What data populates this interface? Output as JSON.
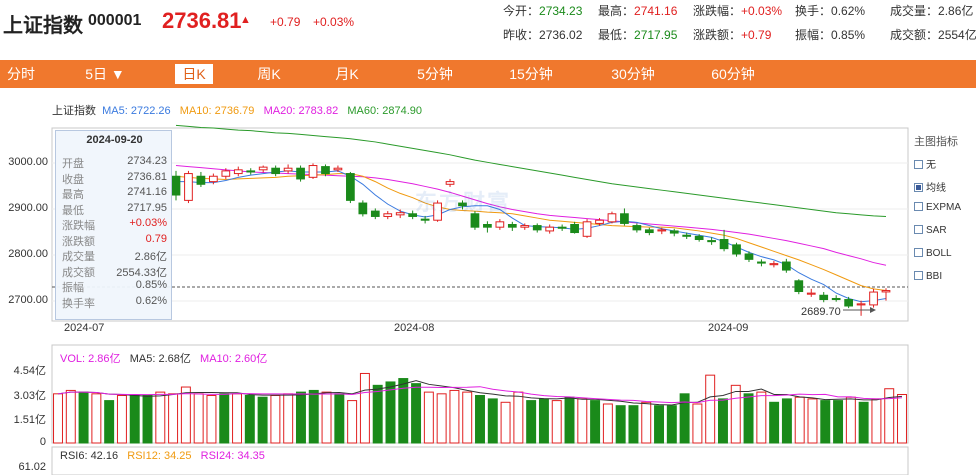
{
  "header": {
    "name": "上证指数",
    "code": "000001",
    "price": "2736.81",
    "arrow": "▲",
    "change": "+0.79",
    "pct": "+0.03%",
    "stats": [
      {
        "label": "今开：",
        "value": "2734.23",
        "tone": "green"
      },
      {
        "label": "最高：",
        "value": "2741.16",
        "tone": "red"
      },
      {
        "label": "涨跌幅：",
        "value": "+0.03%",
        "tone": "red"
      },
      {
        "label": "换手：",
        "value": "0.62%",
        "tone": "plain"
      },
      {
        "label": "成交量：",
        "value": "2.86亿",
        "tone": "plain"
      },
      {
        "label": "昨收：",
        "value": "2736.02",
        "tone": "plain"
      },
      {
        "label": "最低：",
        "value": "2717.95",
        "tone": "green"
      },
      {
        "label": "涨跌额：",
        "value": "+0.79",
        "tone": "red"
      },
      {
        "label": "振幅：",
        "value": "0.85%",
        "tone": "plain"
      },
      {
        "label": "成交额：",
        "value": "2554亿",
        "tone": "plain"
      }
    ]
  },
  "tabs": [
    {
      "label": "分时",
      "active": false
    },
    {
      "label": "5日 ▼",
      "active": false
    },
    {
      "label": "日K",
      "active": true
    },
    {
      "label": "周K",
      "active": false
    },
    {
      "label": "月K",
      "active": false
    },
    {
      "label": "5分钟",
      "active": false
    },
    {
      "label": "15分钟",
      "active": false
    },
    {
      "label": "30分钟",
      "active": false
    },
    {
      "label": "60分钟",
      "active": false
    }
  ],
  "ma_legend": {
    "name": "上证指数",
    "ma5": "MA5: 2722.26",
    "ma10": "MA10: 2736.79",
    "ma20": "MA20: 2783.82",
    "ma60": "MA60: 2874.90"
  },
  "vol_legend": {
    "vol": "VOL: 2.86亿",
    "ma5": "MA5: 2.68亿",
    "ma10": "MA10: 2.60亿"
  },
  "rsi_legend": {
    "rsi6": "RSI6: 42.16",
    "rsi12": "RSI12: 34.25",
    "rsi24": "RSI24: 34.35"
  },
  "price_axis": [
    "3000.00",
    "2900.00",
    "2800.00",
    "2700.00"
  ],
  "vol_axis": [
    "4.54亿",
    "3.03亿",
    "1.51亿",
    "0"
  ],
  "rsi_axis": [
    "61.02"
  ],
  "dates": [
    "2024-07",
    "2024-08",
    "2024-09"
  ],
  "low_marker": "2689.70",
  "watermark": "东方财富",
  "tooltip": {
    "date": "2024-09-20",
    "rows": [
      {
        "k": "开盘",
        "v": "2734.23",
        "tone": "plain"
      },
      {
        "k": "收盘",
        "v": "2736.81",
        "tone": "plain"
      },
      {
        "k": "最高",
        "v": "2741.16",
        "tone": "plain"
      },
      {
        "k": "最低",
        "v": "2717.95",
        "tone": "plain"
      },
      {
        "k": "涨跌幅",
        "v": "+0.03%",
        "tone": "red"
      },
      {
        "k": "涨跌额",
        "v": "0.79",
        "tone": "red"
      },
      {
        "k": "成交量",
        "v": "2.86亿",
        "tone": "plain"
      },
      {
        "k": "成交额",
        "v": "2554.33亿",
        "tone": "plain"
      },
      {
        "k": "振幅",
        "v": "0.85%",
        "tone": "plain"
      },
      {
        "k": "换手率",
        "v": "0.62%",
        "tone": "plain"
      }
    ]
  },
  "indicator_panel": {
    "title": "主图指标",
    "items": [
      {
        "label": "无",
        "checked": false
      },
      {
        "label": "均线",
        "checked": true
      },
      {
        "label": "EXPMA",
        "checked": false
      },
      {
        "label": "SAR",
        "checked": false
      },
      {
        "label": "BOLL",
        "checked": false
      },
      {
        "label": "BBI",
        "checked": false
      }
    ]
  },
  "colors": {
    "up": "#e02020",
    "down": "#1a8a1a",
    "ma5": "#3a7adf",
    "ma10": "#f09a10",
    "ma20": "#e020e0",
    "ma60": "#2a9a2a",
    "tab_bg": "#f0782d"
  },
  "chart_data": {
    "type": "candlestick",
    "price_ylim": [
      2680,
      3040
    ],
    "candles": [
      {
        "o": 2950,
        "c": 2915,
        "h": 2960,
        "l": 2905
      },
      {
        "o": 2905,
        "c": 2955,
        "h": 2960,
        "l": 2900
      },
      {
        "o": 2950,
        "c": 2935,
        "h": 2958,
        "l": 2930
      },
      {
        "o": 2940,
        "c": 2950,
        "h": 2955,
        "l": 2935
      },
      {
        "o": 2950,
        "c": 2960,
        "h": 2965,
        "l": 2945
      },
      {
        "o": 2955,
        "c": 2962,
        "h": 2968,
        "l": 2950
      },
      {
        "o": 2960,
        "c": 2958,
        "h": 2965,
        "l": 2953
      },
      {
        "o": 2962,
        "c": 2967,
        "h": 2970,
        "l": 2957
      },
      {
        "o": 2965,
        "c": 2955,
        "h": 2970,
        "l": 2950
      },
      {
        "o": 2960,
        "c": 2965,
        "h": 2972,
        "l": 2955
      },
      {
        "o": 2965,
        "c": 2945,
        "h": 2970,
        "l": 2940
      },
      {
        "o": 2948,
        "c": 2970,
        "h": 2974,
        "l": 2945
      },
      {
        "o": 2968,
        "c": 2955,
        "h": 2972,
        "l": 2950
      },
      {
        "o": 2962,
        "c": 2965,
        "h": 2970,
        "l": 2958
      },
      {
        "o": 2955,
        "c": 2905,
        "h": 2958,
        "l": 2900
      },
      {
        "o": 2900,
        "c": 2880,
        "h": 2905,
        "l": 2875
      },
      {
        "o": 2885,
        "c": 2875,
        "h": 2890,
        "l": 2870
      },
      {
        "o": 2875,
        "c": 2880,
        "h": 2885,
        "l": 2870
      },
      {
        "o": 2878,
        "c": 2882,
        "h": 2888,
        "l": 2872
      },
      {
        "o": 2880,
        "c": 2875,
        "h": 2886,
        "l": 2870
      },
      {
        "o": 2870,
        "c": 2868,
        "h": 2876,
        "l": 2862
      },
      {
        "o": 2868,
        "c": 2900,
        "h": 2905,
        "l": 2865
      },
      {
        "o": 2935,
        "c": 2940,
        "h": 2945,
        "l": 2930
      },
      {
        "o": 2900,
        "c": 2895,
        "h": 2905,
        "l": 2888
      },
      {
        "o": 2880,
        "c": 2855,
        "h": 2885,
        "l": 2850
      },
      {
        "o": 2860,
        "c": 2855,
        "h": 2866,
        "l": 2845
      },
      {
        "o": 2855,
        "c": 2865,
        "h": 2870,
        "l": 2850
      },
      {
        "o": 2860,
        "c": 2855,
        "h": 2865,
        "l": 2848
      },
      {
        "o": 2855,
        "c": 2858,
        "h": 2862,
        "l": 2850
      },
      {
        "o": 2858,
        "c": 2850,
        "h": 2862,
        "l": 2845
      },
      {
        "o": 2848,
        "c": 2855,
        "h": 2860,
        "l": 2843
      },
      {
        "o": 2855,
        "c": 2853,
        "h": 2860,
        "l": 2848
      },
      {
        "o": 2860,
        "c": 2845,
        "h": 2865,
        "l": 2843
      },
      {
        "o": 2838,
        "c": 2865,
        "h": 2870,
        "l": 2835
      },
      {
        "o": 2862,
        "c": 2868,
        "h": 2872,
        "l": 2858
      },
      {
        "o": 2865,
        "c": 2880,
        "h": 2884,
        "l": 2862
      },
      {
        "o": 2880,
        "c": 2862,
        "h": 2890,
        "l": 2858
      },
      {
        "o": 2858,
        "c": 2850,
        "h": 2862,
        "l": 2845
      },
      {
        "o": 2850,
        "c": 2845,
        "h": 2854,
        "l": 2840
      },
      {
        "o": 2848,
        "c": 2850,
        "h": 2854,
        "l": 2842
      },
      {
        "o": 2848,
        "c": 2844,
        "h": 2852,
        "l": 2838
      },
      {
        "o": 2840,
        "c": 2838,
        "h": 2845,
        "l": 2833
      },
      {
        "o": 2838,
        "c": 2832,
        "h": 2842,
        "l": 2828
      },
      {
        "o": 2830,
        "c": 2828,
        "h": 2836,
        "l": 2822
      },
      {
        "o": 2832,
        "c": 2815,
        "h": 2850,
        "l": 2810
      },
      {
        "o": 2822,
        "c": 2805,
        "h": 2826,
        "l": 2800
      },
      {
        "o": 2805,
        "c": 2795,
        "h": 2810,
        "l": 2790
      },
      {
        "o": 2790,
        "c": 2788,
        "h": 2795,
        "l": 2782
      },
      {
        "o": 2785,
        "c": 2787,
        "h": 2792,
        "l": 2780
      },
      {
        "o": 2790,
        "c": 2775,
        "h": 2796,
        "l": 2770
      },
      {
        "o": 2755,
        "c": 2735,
        "h": 2758,
        "l": 2730
      },
      {
        "o": 2730,
        "c": 2732,
        "h": 2740,
        "l": 2725
      },
      {
        "o": 2728,
        "c": 2720,
        "h": 2734,
        "l": 2715
      },
      {
        "o": 2722,
        "c": 2720,
        "h": 2728,
        "l": 2716
      },
      {
        "o": 2720,
        "c": 2708,
        "h": 2725,
        "l": 2704
      },
      {
        "o": 2710,
        "c": 2712,
        "h": 2718,
        "l": 2689.7
      },
      {
        "o": 2710,
        "c": 2734,
        "h": 2740,
        "l": 2705
      },
      {
        "o": 2734.23,
        "c": 2736.81,
        "h": 2741.16,
        "l": 2717.95
      }
    ],
    "ma5": [
      2940,
      2940,
      2938,
      2938,
      2942,
      2948,
      2952,
      2955,
      2958,
      2960,
      2958,
      2958,
      2958,
      2960,
      2950,
      2935,
      2915,
      2898,
      2885,
      2878,
      2874,
      2878,
      2888,
      2893,
      2895,
      2895,
      2888,
      2872,
      2858,
      2856,
      2855,
      2854,
      2851,
      2853,
      2858,
      2864,
      2866,
      2864,
      2858,
      2852,
      2848,
      2844,
      2840,
      2836,
      2828,
      2818,
      2808,
      2800,
      2794,
      2785,
      2770,
      2758,
      2748,
      2732,
      2722,
      2716,
      2718,
      2722
    ],
    "ma10": [
      2950,
      2948,
      2946,
      2945,
      2944,
      2945,
      2946,
      2947,
      2948,
      2950,
      2951,
      2952,
      2953,
      2955,
      2955,
      2950,
      2940,
      2928,
      2918,
      2910,
      2900,
      2893,
      2888,
      2886,
      2885,
      2883,
      2882,
      2880,
      2876,
      2872,
      2868,
      2866,
      2864,
      2862,
      2860,
      2858,
      2857,
      2856,
      2855,
      2855,
      2854,
      2851,
      2848,
      2844,
      2840,
      2834,
      2826,
      2818,
      2810,
      2802,
      2794,
      2785,
      2776,
      2766,
      2756,
      2746,
      2740,
      2737
    ],
    "ma20": [
      2970,
      2968,
      2966,
      2964,
      2962,
      2960,
      2958,
      2957,
      2956,
      2955,
      2954,
      2953,
      2952,
      2951,
      2950,
      2949,
      2947,
      2944,
      2940,
      2936,
      2931,
      2926,
      2920,
      2913,
      2906,
      2899,
      2893,
      2888,
      2884,
      2880,
      2877,
      2875,
      2873,
      2871,
      2869,
      2867,
      2865,
      2863,
      2861,
      2859,
      2857,
      2855,
      2853,
      2851,
      2848,
      2845,
      2842,
      2838,
      2834,
      2830,
      2825,
      2820,
      2815,
      2808,
      2802,
      2796,
      2789,
      2784
    ],
    "ma60": [
      3045,
      3043,
      3041,
      3040,
      3038,
      3036,
      3035,
      3033,
      3031,
      3030,
      3028,
      3026,
      3024,
      3022,
      3020,
      3017,
      3014,
      3010,
      3006,
      3002,
      2998,
      2994,
      2990,
      2985,
      2980,
      2976,
      2972,
      2968,
      2964,
      2960,
      2956,
      2952,
      2948,
      2944,
      2940,
      2936,
      2933,
      2930,
      2927,
      2924,
      2921,
      2918,
      2915,
      2912,
      2909,
      2906,
      2903,
      2900,
      2897,
      2894,
      2891,
      2888,
      2885,
      2882,
      2880,
      2878,
      2876,
      2875
    ],
    "volume": [
      2.9,
      3.1,
      3.0,
      2.9,
      2.5,
      2.8,
      2.8,
      2.8,
      3.0,
      2.9,
      3.3,
      2.9,
      2.8,
      2.9,
      2.9,
      2.8,
      2.7,
      2.8,
      2.9,
      3.0,
      3.1,
      3.0,
      2.9,
      2.5,
      4.1,
      3.4,
      3.6,
      3.8,
      3.5,
      3.0,
      2.9,
      3.1,
      3.0,
      2.8,
      2.6,
      2.4,
      3.0,
      2.5,
      2.6,
      2.5,
      2.7,
      2.6,
      2.5,
      2.3,
      2.2,
      2.2,
      2.4,
      2.2,
      2.2,
      2.9,
      2.3,
      4.0,
      2.6,
      3.4,
      2.9,
      3.0,
      2.4,
      2.6,
      2.7,
      2.6,
      2.5,
      2.5,
      2.7,
      2.4,
      2.6,
      3.2,
      2.86
    ],
    "vol_up": [
      true,
      true,
      false,
      true,
      false,
      true,
      false,
      false,
      true,
      true,
      true,
      true,
      true,
      false,
      true,
      false,
      false,
      true,
      true,
      false,
      false,
      true,
      false,
      true,
      true,
      false,
      false,
      false,
      false,
      true,
      true,
      true,
      true,
      false,
      false,
      true,
      true,
      false,
      false,
      true,
      false,
      true,
      false,
      true,
      false,
      false,
      true,
      false,
      false,
      false,
      true,
      true,
      false,
      true,
      false,
      true,
      false,
      false,
      true,
      true,
      false,
      false,
      true,
      false,
      true,
      true,
      true
    ],
    "vol_ylim": [
      0,
      4.54
    ]
  }
}
